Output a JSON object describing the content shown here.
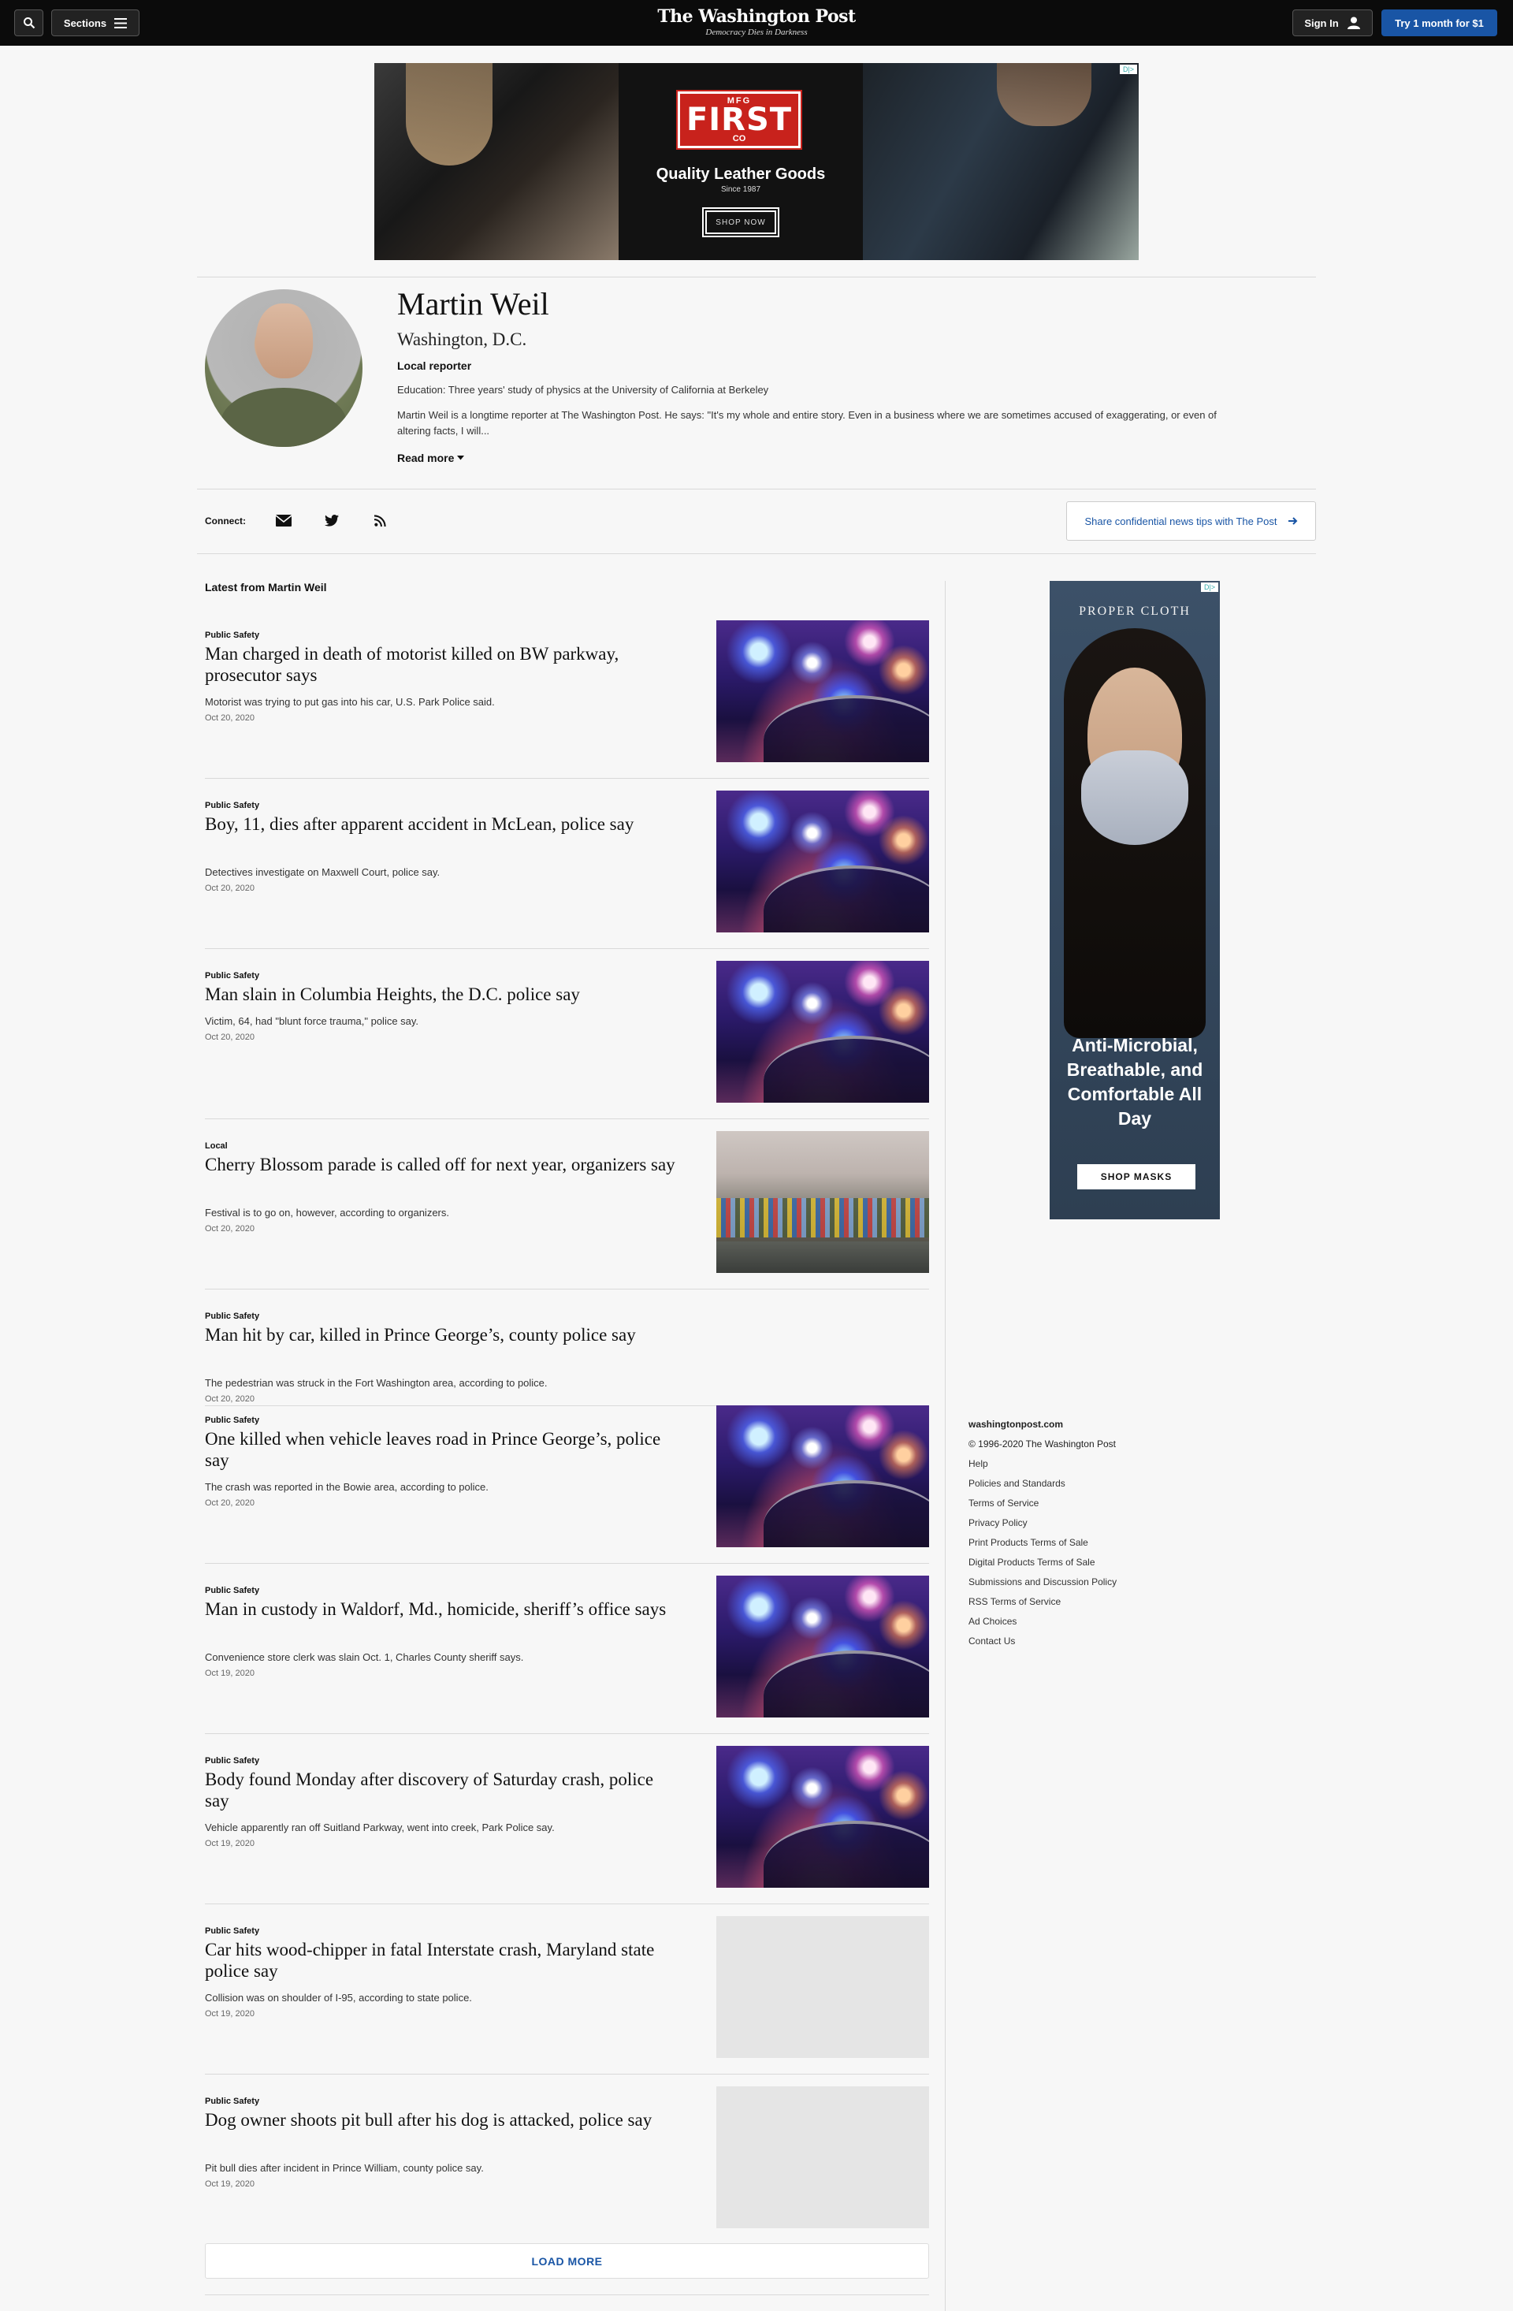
{
  "header": {
    "logo_text": "The Washington Post",
    "tagline": "Democracy Dies in Darkness",
    "sections_label": "Sections",
    "signin_label": "Sign In",
    "try_label": "Try 1 month for $1",
    "search_icon": "search-icon",
    "menu_icon": "hamburger-icon",
    "user_icon": "user-icon"
  },
  "top_ad": {
    "mfg": "MFG",
    "logo": "FIRST",
    "co": "CO",
    "headline": "Quality Leather Goods",
    "since": "Since 1987",
    "cta": "SHOP NOW",
    "ad_choices": "D|>"
  },
  "author": {
    "name": "Martin Weil",
    "location": "Washington, D.C.",
    "role": "Local reporter",
    "education": "Education: Three years' study of physics at the University of California at Berkeley",
    "bio": "Martin Weil is a longtime reporter at The Washington Post. He says: \"It's my whole and entire story. Even in a business where we are sometimes accused of exaggerating, or even of altering facts, I will...",
    "read_more": "Read more"
  },
  "connect": {
    "label": "Connect:",
    "icons": [
      "email-icon",
      "twitter-icon",
      "rss-icon"
    ],
    "tips_label": "Share confidential news tips with The Post"
  },
  "latest_label": "Latest from Martin Weil",
  "articles": [
    {
      "kicker": "Public Safety",
      "headline": "Man charged in death of motorist killed on BW parkway, prosecutor says",
      "blurb": "Motorist was trying to put gas into his car, U.S. Park Police said.",
      "date": "Oct 20, 2020",
      "image": "police"
    },
    {
      "kicker": "Public Safety",
      "headline": "Boy, 11, dies after apparent accident in McLean, police say",
      "blurb": "Detectives investigate on Maxwell Court, police say.",
      "date": "Oct 20, 2020",
      "image": "police"
    },
    {
      "kicker": "Public Safety",
      "headline": "Man slain in Columbia Heights, the D.C. police say",
      "blurb": "Victim, 64, had \"blunt force trauma,\" police say.",
      "date": "Oct 20, 2020",
      "image": "police"
    },
    {
      "kicker": "Local",
      "headline": "Cherry Blossom parade is called off for next year, organizers say",
      "blurb": "Festival is to go on, however, according to organizers.",
      "date": "Oct 20, 2020",
      "image": "cherry"
    },
    {
      "kicker": "Public Safety",
      "headline": "Man hit by car, killed in Prince George’s, county police say",
      "blurb": "The pedestrian was struck in the Fort Washington area, according to police.",
      "date": "Oct 20, 2020",
      "image": "none"
    },
    {
      "kicker": "Public Safety",
      "headline": "One killed when vehicle leaves road in Prince George’s, police say",
      "blurb": "The crash was reported in the Bowie area, according to police.",
      "date": "Oct 20, 2020",
      "image": "police"
    },
    {
      "kicker": "Public Safety",
      "headline": "Man in custody in Waldorf, Md., homicide, sheriff’s office says",
      "blurb": "Convenience store clerk was slain Oct. 1, Charles County sheriff says.",
      "date": "Oct 19, 2020",
      "image": "police"
    },
    {
      "kicker": "Public Safety",
      "headline": "Body found Monday after discovery of Saturday crash, police say",
      "blurb": "Vehicle apparently ran off Suitland Parkway, went into creek, Park Police say.",
      "date": "Oct 19, 2020",
      "image": "police"
    },
    {
      "kicker": "Public Safety",
      "headline": "Car hits wood-chipper in fatal Interstate crash, Maryland state police say",
      "blurb": "Collision was on shoulder of I-95, according to state police.",
      "date": "Oct 19, 2020",
      "image": "empty"
    },
    {
      "kicker": "Public Safety",
      "headline": "Dog owner shoots pit bull after his dog is attacked, police say",
      "blurb": "Pit bull dies after incident in Prince William, county police say.",
      "date": "Oct 19, 2020",
      "image": "empty"
    }
  ],
  "load_more": "LOAD MORE",
  "side_ad": {
    "brand": "PROPER CLOTH",
    "copy": "Anti-Microbial, Breathable, and Comfortable All Day",
    "cta": "SHOP MASKS",
    "ad_choices": "D|>"
  },
  "footer": {
    "site": "washingtonpost.com",
    "copyright": "© 1996-2020 The Washington Post",
    "links": [
      "Help",
      "Policies and Standards",
      "Terms of Service",
      "Privacy Policy",
      "Print Products Terms of Sale",
      "Digital Products Terms of Sale",
      "Submissions and Discussion Policy",
      "RSS Terms of Service",
      "Ad Choices",
      "Contact Us"
    ]
  },
  "colors": {
    "accent": "#1955a5",
    "topbar": "#0b0b0b",
    "background": "#f7f7f7"
  }
}
